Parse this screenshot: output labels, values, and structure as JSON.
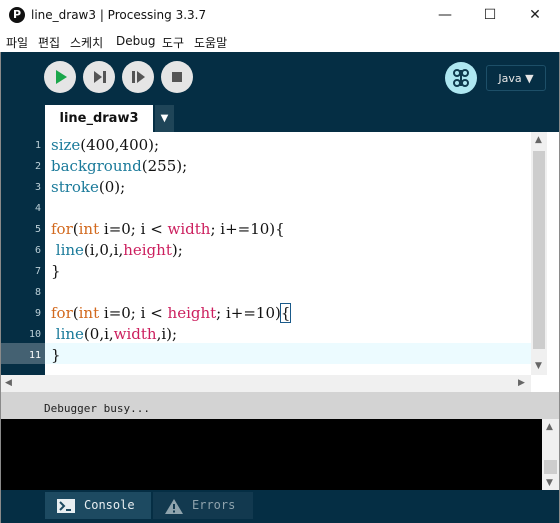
{
  "window": {
    "title": "line_draw3 | Processing 3.3.7",
    "app_icon_letter": "P",
    "minimize": "—",
    "maximize": "☐",
    "close": "✕"
  },
  "menu": [
    "파일",
    "편집",
    "스케치",
    "Debug",
    "도구",
    "도움말"
  ],
  "toolbar": {
    "run_icon": "play-icon",
    "step_icon": "step-icon",
    "continue_icon": "continue-icon",
    "stop_icon": "stop-icon",
    "debug_icon": "debugger-icon",
    "mode": "Java ▼"
  },
  "tabs": {
    "active": "line_draw3",
    "menu_arrow": "▼"
  },
  "editor": {
    "line_numbers": [
      "1",
      "2",
      "3",
      "4",
      "5",
      "6",
      "7",
      "8",
      "9",
      "10",
      "11"
    ],
    "current_line": 11
  },
  "debug_status": "Debugger busy...",
  "bottom_tabs": {
    "console": "Console",
    "errors": "Errors"
  },
  "colors": {
    "accent": "#052e44",
    "keyword": "#d2691e",
    "function": "#1a7a9a",
    "constant": "#cc1f5e"
  }
}
